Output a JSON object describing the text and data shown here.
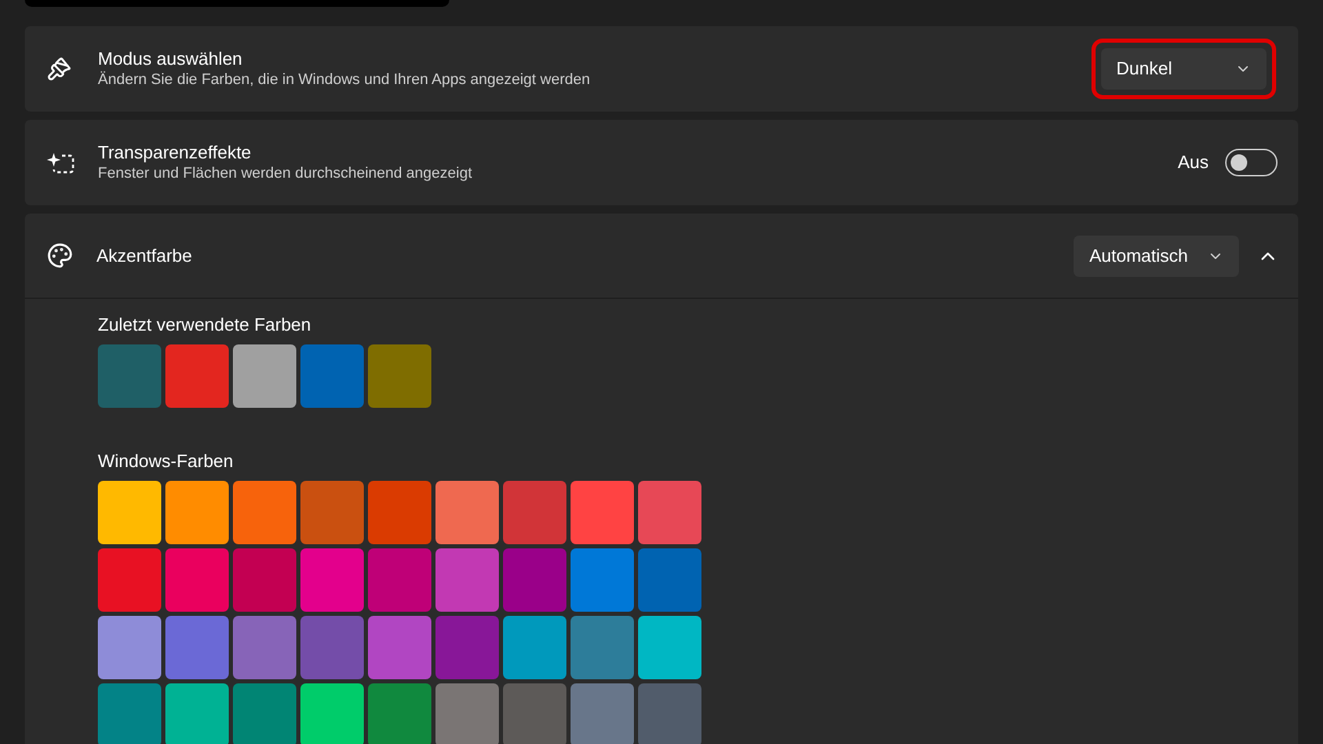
{
  "mode_card": {
    "title": "Modus auswählen",
    "subtitle": "Ändern Sie die Farben, die in Windows und Ihren Apps angezeigt werden",
    "dropdown": {
      "value": "Dunkel",
      "highlighted": true
    }
  },
  "transparency_card": {
    "title": "Transparenzeffekte",
    "subtitle": "Fenster und Flächen werden durchscheinend angezeigt",
    "toggle": {
      "label": "Aus",
      "on": false
    }
  },
  "accent_card": {
    "title": "Akzentfarbe",
    "dropdown": {
      "value": "Automatisch"
    },
    "expanded": true,
    "recent": {
      "label": "Zuletzt verwendete Farben",
      "swatches": [
        {
          "color": "#1f5f66"
        },
        {
          "color": "#e3261f"
        },
        {
          "color": "#a0a0a0"
        },
        {
          "color": "#0063b1"
        },
        {
          "color": "#7f6d00"
        }
      ]
    },
    "windows": {
      "label": "Windows-Farben",
      "swatches": [
        {
          "color": "#ffb900"
        },
        {
          "color": "#ff8c00"
        },
        {
          "color": "#f7630c"
        },
        {
          "color": "#ca5010"
        },
        {
          "color": "#da3b01"
        },
        {
          "color": "#ef6950"
        },
        {
          "color": "#d13438"
        },
        {
          "color": "#ff4343"
        },
        {
          "color": "#e74856"
        },
        {
          "color": "#e81123"
        },
        {
          "color": "#ea005e"
        },
        {
          "color": "#c30052"
        },
        {
          "color": "#e3008c"
        },
        {
          "color": "#bf0077"
        },
        {
          "color": "#c239b3"
        },
        {
          "color": "#9a0089"
        },
        {
          "color": "#0078d7"
        },
        {
          "color": "#0063b1"
        },
        {
          "color": "#8e8cd8"
        },
        {
          "color": "#6b69d6"
        },
        {
          "color": "#8764b8"
        },
        {
          "color": "#744da9"
        },
        {
          "color": "#b146c2"
        },
        {
          "color": "#881798"
        },
        {
          "color": "#0099bc"
        },
        {
          "color": "#2d7d9a"
        },
        {
          "color": "#00b7c3"
        },
        {
          "color": "#038387"
        },
        {
          "color": "#00b294"
        },
        {
          "color": "#018574"
        },
        {
          "color": "#00cc6a"
        },
        {
          "color": "#10893e"
        },
        {
          "color": "#7a7574"
        },
        {
          "color": "#5d5a58"
        },
        {
          "color": "#68768a"
        },
        {
          "color": "#515c6b"
        }
      ]
    }
  }
}
